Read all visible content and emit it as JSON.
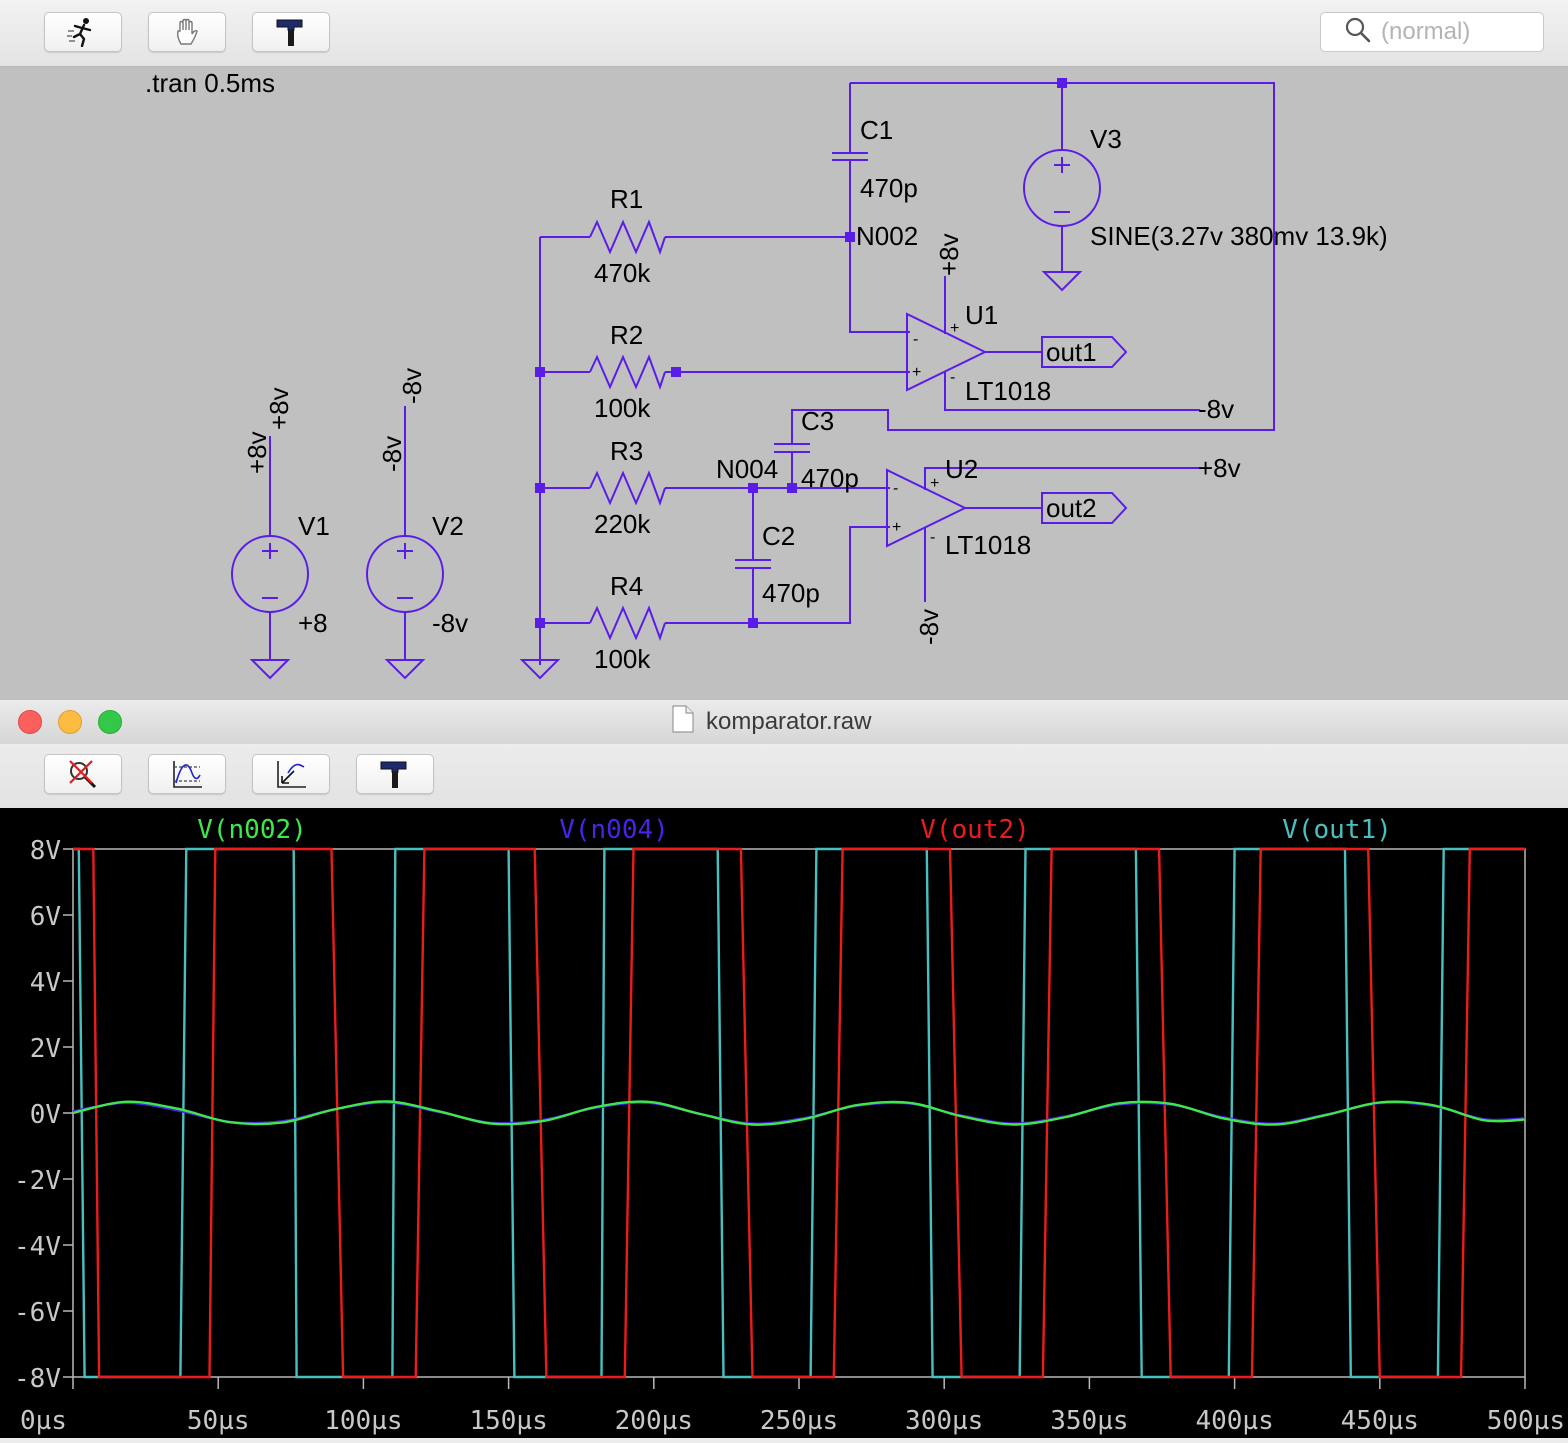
{
  "schematic_toolbar": {
    "buttons": [
      {
        "name": "run-button",
        "icon": "running-man-icon"
      },
      {
        "name": "pan-button",
        "icon": "hand-icon"
      },
      {
        "name": "hammer-button",
        "icon": "hammer-icon"
      }
    ],
    "search_placeholder": "(normal)"
  },
  "schematic": {
    "directive": ".tran 0.5ms",
    "wire_color": "#5a1de8",
    "components": {
      "R1": {
        "name": "R1",
        "value": "470k"
      },
      "R2": {
        "name": "R2",
        "value": "100k"
      },
      "R3": {
        "name": "R3",
        "value": "220k"
      },
      "R4": {
        "name": "R4",
        "value": "100k"
      },
      "C1": {
        "name": "C1",
        "value": "470p"
      },
      "C2": {
        "name": "C2",
        "value": "470p"
      },
      "C3": {
        "name": "C3",
        "value": "470p"
      },
      "V1": {
        "name": "V1",
        "value": "+8"
      },
      "V2": {
        "name": "V2",
        "value": "-8v"
      },
      "V3": {
        "name": "V3",
        "value": "SINE(3.27v 380mv 13.9k)"
      },
      "U1": {
        "name": "U1",
        "value": "LT1018"
      },
      "U2": {
        "name": "U2",
        "value": "LT1018"
      }
    },
    "net_labels": {
      "n002": "N002",
      "n004": "N004",
      "pos": "+8v",
      "neg": "-8v"
    },
    "ports": {
      "out1": "out1",
      "out2": "out2"
    },
    "opamp_pins": {
      "plus": "+",
      "minus": "-"
    }
  },
  "plot_window": {
    "title": "komparator.raw",
    "toolbar_buttons": [
      {
        "name": "zoom-cancel-button",
        "icon": "zoom-cancel-icon"
      },
      {
        "name": "autorange-button",
        "icon": "autorange-icon"
      },
      {
        "name": "pan-plot-button",
        "icon": "pan-plot-icon"
      },
      {
        "name": "plot-hammer-button",
        "icon": "hammer-icon"
      }
    ]
  },
  "chart_data": {
    "type": "line",
    "xlabel": "",
    "ylabel": "",
    "xlim": [
      0,
      500
    ],
    "ylim": [
      -8,
      8
    ],
    "x_unit": "µs",
    "y_unit": "V",
    "x_ticks": [
      "0µs",
      "50µs",
      "100µs",
      "150µs",
      "200µs",
      "250µs",
      "300µs",
      "350µs",
      "400µs",
      "450µs",
      "500µs"
    ],
    "y_ticks": [
      "8V",
      "6V",
      "4V",
      "2V",
      "0V",
      "-2V",
      "-4V",
      "-6V",
      "-8V"
    ],
    "legend_position": "top",
    "background": "#000000",
    "series": [
      {
        "name": "V(n002)",
        "color": "#3fe84a",
        "x": [
          0,
          18,
          36,
          54,
          72,
          90,
          108,
          126,
          144,
          162,
          180,
          198,
          216,
          234,
          252,
          270,
          288,
          306,
          324,
          342,
          360,
          378,
          396,
          414,
          432,
          450,
          468,
          486,
          500
        ],
        "y": [
          0.0,
          0.34,
          0.13,
          -0.28,
          -0.29,
          0.11,
          0.35,
          0.05,
          -0.32,
          -0.24,
          0.18,
          0.34,
          -0.03,
          -0.35,
          -0.18,
          0.24,
          0.31,
          -0.1,
          -0.35,
          -0.12,
          0.29,
          0.28,
          -0.16,
          -0.35,
          -0.05,
          0.32,
          0.24,
          -0.22,
          -0.2
        ]
      },
      {
        "name": "V(n004)",
        "color": "#4a22e8",
        "x": [
          0,
          18,
          36,
          54,
          72,
          90,
          108,
          126,
          144,
          162,
          180,
          198,
          216,
          234,
          252,
          270,
          288,
          306,
          324,
          342,
          360,
          378,
          396,
          414,
          432,
          450,
          468,
          486,
          500
        ],
        "y": [
          0.05,
          0.31,
          0.08,
          -0.27,
          -0.25,
          0.11,
          0.32,
          0.03,
          -0.3,
          -0.21,
          0.16,
          0.31,
          -0.03,
          -0.32,
          -0.15,
          0.22,
          0.29,
          -0.08,
          -0.32,
          -0.1,
          0.26,
          0.26,
          -0.13,
          -0.32,
          -0.04,
          0.3,
          0.22,
          -0.19,
          -0.16
        ]
      },
      {
        "name": "V(out2)",
        "color": "#ec1c1c",
        "x": [
          0,
          5,
          7,
          9,
          12,
          40,
          47,
          49,
          53,
          57,
          79,
          85,
          89,
          93,
          96,
          112,
          118,
          121,
          125,
          128,
          148,
          155,
          159,
          163,
          166,
          183,
          190,
          193,
          197,
          200,
          220,
          227,
          230,
          234,
          237,
          255,
          262,
          265,
          269,
          272,
          292,
          299,
          302,
          306,
          309,
          327,
          334,
          337,
          341,
          344,
          364,
          371,
          374,
          378,
          381,
          399,
          406,
          409,
          413,
          416,
          436,
          443,
          446,
          450,
          453,
          471,
          478,
          481,
          485,
          488,
          500
        ],
        "y": [
          8,
          8,
          8,
          -8,
          -8,
          -8,
          -8,
          8,
          8,
          8,
          8,
          8,
          8,
          -8,
          -8,
          -8,
          -8,
          8,
          8,
          8,
          8,
          8,
          8,
          -8,
          -8,
          -8,
          -8,
          8,
          8,
          8,
          8,
          8,
          8,
          -8,
          -8,
          -8,
          -8,
          8,
          8,
          8,
          8,
          8,
          8,
          -8,
          -8,
          -8,
          -8,
          8,
          8,
          8,
          8,
          8,
          8,
          -8,
          -8,
          -8,
          -8,
          8,
          8,
          8,
          8,
          8,
          8,
          -8,
          -8,
          -8,
          -8,
          8,
          8,
          8,
          8
        ]
      },
      {
        "name": "V(out1)",
        "color": "#48c0c0",
        "x": [
          0,
          1,
          2,
          4,
          5,
          36,
          37,
          39,
          40,
          74,
          76,
          77,
          78,
          108,
          110,
          111,
          113,
          148,
          150,
          152,
          153,
          180,
          182,
          183,
          185,
          220,
          222,
          224,
          225,
          252,
          254,
          256,
          257,
          292,
          294,
          296,
          297,
          324,
          326,
          328,
          329,
          364,
          366,
          368,
          369,
          396,
          398,
          400,
          401,
          436,
          438,
          440,
          441,
          468,
          470,
          472,
          473,
          500
        ],
        "y": [
          8,
          8,
          8,
          -8,
          -8,
          -8,
          -8,
          8,
          8,
          8,
          8,
          -8,
          -8,
          -8,
          -8,
          8,
          8,
          8,
          8,
          -8,
          -8,
          -8,
          -8,
          8,
          8,
          8,
          8,
          -8,
          -8,
          -8,
          -8,
          8,
          8,
          8,
          8,
          -8,
          -8,
          -8,
          -8,
          8,
          8,
          8,
          8,
          -8,
          -8,
          -8,
          -8,
          8,
          8,
          8,
          8,
          -8,
          -8,
          -8,
          -8,
          8,
          8,
          8
        ]
      }
    ]
  }
}
